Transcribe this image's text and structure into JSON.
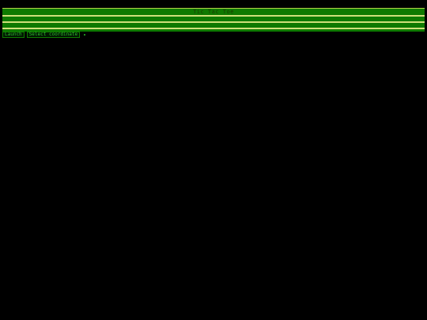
{
  "window": {
    "title": "Tic Tac Toe",
    "accent": "#0f7a00",
    "line_color": "#cfe07a"
  },
  "toolbar": {
    "launch_label": "Launch",
    "select_label": "Select coordinate"
  }
}
